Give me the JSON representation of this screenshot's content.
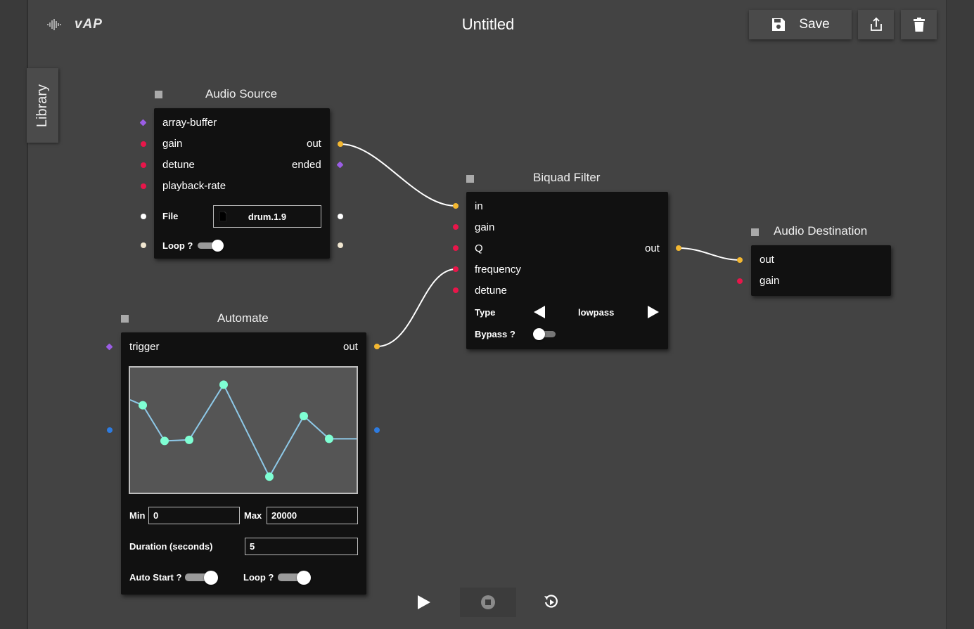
{
  "app": {
    "logo": "vAP",
    "title": "Untitled"
  },
  "toolbar": {
    "save_label": "Save"
  },
  "library": {
    "label": "Library"
  },
  "audio_source": {
    "title": "Audio Source",
    "array_buffer": "array-buffer",
    "gain": "gain",
    "detune": "detune",
    "playback_rate": "playback-rate",
    "out": "out",
    "ended": "ended",
    "file_label": "File",
    "file_value": "drum.1.9",
    "loop_label": "Loop ?"
  },
  "biquad": {
    "title": "Biquad Filter",
    "in": "in",
    "gain": "gain",
    "q": "Q",
    "frequency": "frequency",
    "detune": "detune",
    "out": "out",
    "type_label": "Type",
    "type_value": "lowpass",
    "bypass_label": "Bypass ?"
  },
  "destination": {
    "title": "Audio Destination",
    "out": "out",
    "gain": "gain"
  },
  "automate": {
    "title": "Automate",
    "trigger": "trigger",
    "out": "out",
    "min_label": "Min",
    "min_value": "0",
    "max_label": "Max",
    "max_value": "20000",
    "duration_label": "Duration (seconds)",
    "duration_value": "5",
    "autostart_label": "Auto Start ?",
    "loop_label": "Loop ?",
    "curve_points": [
      0.78,
      0.73,
      0.4,
      0.41,
      0.92,
      0.07,
      0.63,
      0.42,
      0.42
    ]
  },
  "colors": {
    "audio_port": "#f3b731",
    "param_port": "#e8164a",
    "event_port": "#9b5de5",
    "curve_line": "#8ec9e8",
    "curve_point": "#7fffd4"
  }
}
